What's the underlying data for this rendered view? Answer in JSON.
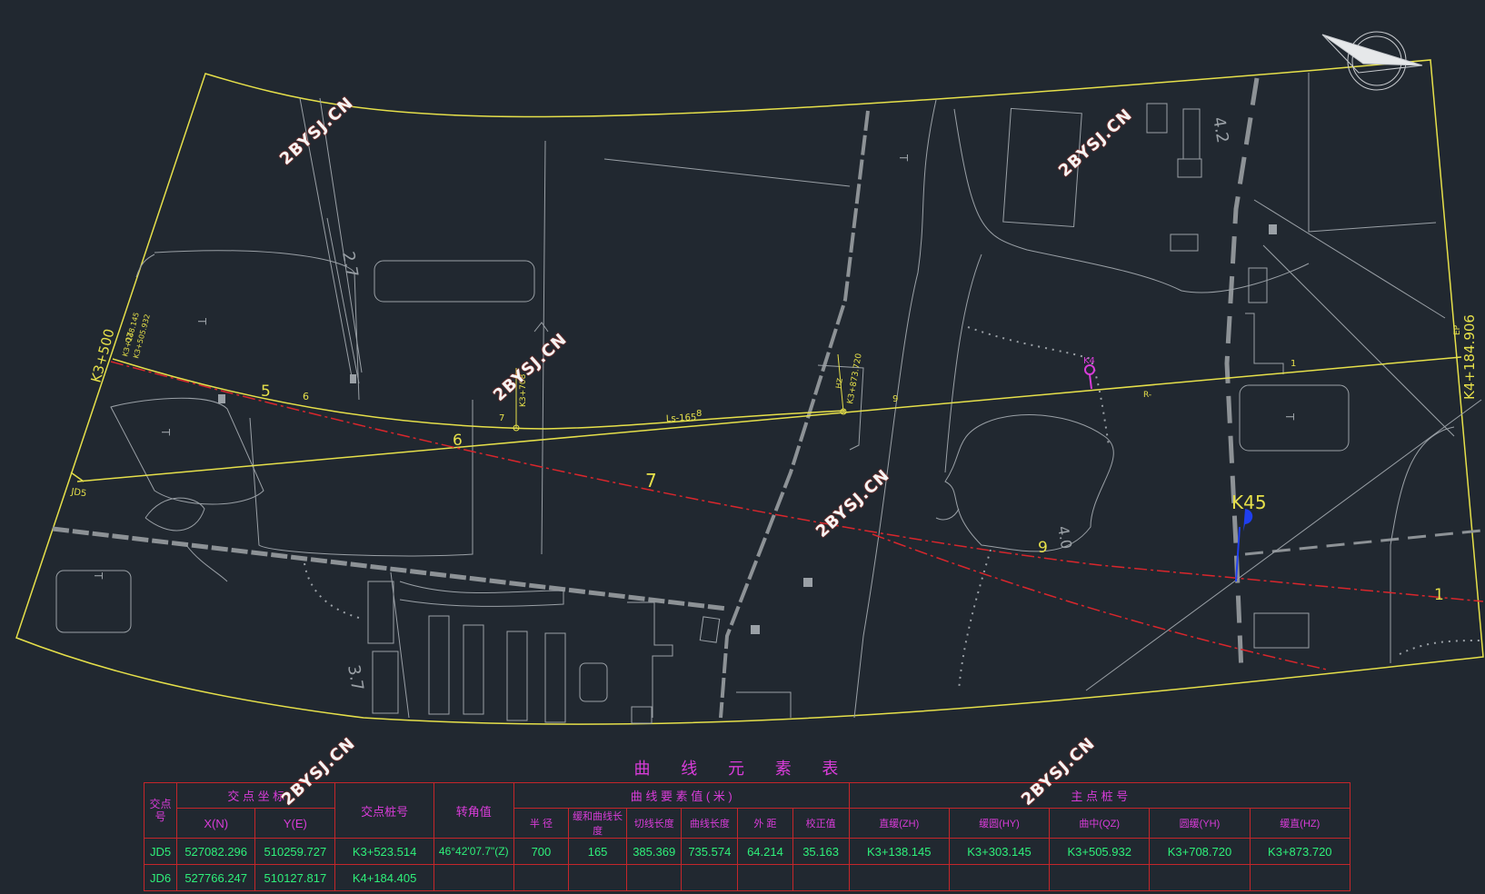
{
  "drawing": {
    "stations": {
      "k3_500": "K3+500",
      "k4_184": "K4+184.906",
      "zh_label": "K3+138.145",
      "qz_label": "K3+505.932",
      "yh_label": "K3+708",
      "hz_label": "K3+873.720",
      "k4": "K4",
      "k45": "K45"
    },
    "markers": [
      "5",
      "6",
      "6",
      "7",
      "7",
      "8",
      "9",
      "9",
      "1",
      "1"
    ],
    "ls_label": "Ls-165",
    "jd_label": "JD5",
    "r_label": "R-",
    "terrain_labels": [
      "2.7",
      "3.7",
      "4.2",
      "4.0",
      "T",
      "T",
      "T",
      "T",
      "T"
    ],
    "ep_label": "EP",
    "qz_small": "QZ",
    "hz_small": "HZ"
  },
  "watermarks": [
    "2BYSJ.CN",
    "2BYSJ.CN",
    "2BYSJ.CN",
    "2BYSJ.CN",
    "2BYSJ.CN",
    "2BYSJ.CN"
  ],
  "table": {
    "title": "曲 线 元 素 表",
    "headers": {
      "jd_no": "交点号",
      "coord": "交 点 坐 标",
      "x": "X(N)",
      "y": "Y(E)",
      "station": "交点桩号",
      "angle": "转角值",
      "elements": "曲 线 要 素 值 ( 米 )",
      "radius": "半 径",
      "transition": "缓和曲线长 度",
      "tangent": "切线长度",
      "curve_len": "曲线长度",
      "external": "外 距",
      "correction": "校正值",
      "main_pts": "主 点 桩 号",
      "zh": "直缓(ZH)",
      "hy": "缓圆(HY)",
      "qz": "曲中(QZ)",
      "yh": "圆缓(YH)",
      "hz": "缓直(HZ)"
    },
    "rows": [
      {
        "jd": "JD5",
        "x": "527082.296",
        "y": "510259.727",
        "station": "K3+523.514",
        "angle": "46°42'07.7\"(Z)",
        "radius": "700",
        "ls": "165",
        "t": "385.369",
        "l": "735.574",
        "e": "64.214",
        "d": "35.163",
        "zh": "K3+138.145",
        "hy": "K3+303.145",
        "qz": "K3+505.932",
        "yh": "K3+708.720",
        "hz": "K3+873.720"
      },
      {
        "jd": "JD6",
        "x": "527766.247",
        "y": "510127.817",
        "station": "K4+184.405",
        "angle": "",
        "radius": "",
        "ls": "",
        "t": "",
        "l": "",
        "e": "",
        "d": "",
        "zh": "",
        "hy": "",
        "qz": "",
        "yh": "",
        "hz": ""
      }
    ]
  },
  "colors": {
    "background": "#212830",
    "boundary": "#e6e04a",
    "terrain": "#9aa0a6",
    "centerline": "#d9262c",
    "magenta": "#d93cd9",
    "value": "#2ef07a"
  }
}
